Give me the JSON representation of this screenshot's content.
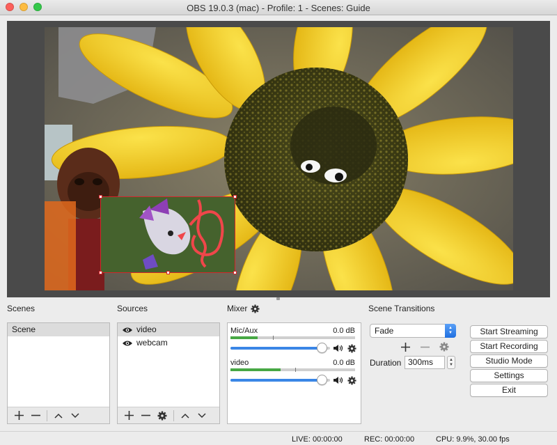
{
  "window": {
    "title": "OBS 19.0.3 (mac) - Profile: 1 - Scenes: Guide"
  },
  "panels": {
    "scenes_label": "Scenes",
    "sources_label": "Sources",
    "mixer_label": "Mixer",
    "transitions_label": "Scene Transitions"
  },
  "scenes": {
    "items": [
      "Scene"
    ]
  },
  "sources": {
    "items": [
      "video",
      "webcam"
    ]
  },
  "mixer": {
    "channels": [
      {
        "name": "Mic/Aux",
        "level": "0.0 dB",
        "volume_fraction": 0.97
      },
      {
        "name": "video",
        "level": "0.0 dB",
        "volume_fraction": 0.97
      }
    ]
  },
  "transitions": {
    "selected": "Fade",
    "duration_label": "Duration",
    "duration_value": "300ms"
  },
  "controls": {
    "start_streaming": "Start Streaming",
    "start_recording": "Start Recording",
    "studio_mode": "Studio Mode",
    "settings": "Settings",
    "exit": "Exit"
  },
  "status": {
    "live": "LIVE: 00:00:00",
    "rec": "REC: 00:00:00",
    "cpu": "CPU: 9.9%, 30.00 fps"
  },
  "colors": {
    "selection_outline": "#d4252a",
    "scribble": "#f0464a",
    "meter_green": "#47a844",
    "fader_blue": "#3a86e6"
  },
  "icons": [
    "eye-icon",
    "plus-icon",
    "minus-icon",
    "gear-icon",
    "chevron-up-icon",
    "chevron-down-icon",
    "speaker-icon"
  ]
}
